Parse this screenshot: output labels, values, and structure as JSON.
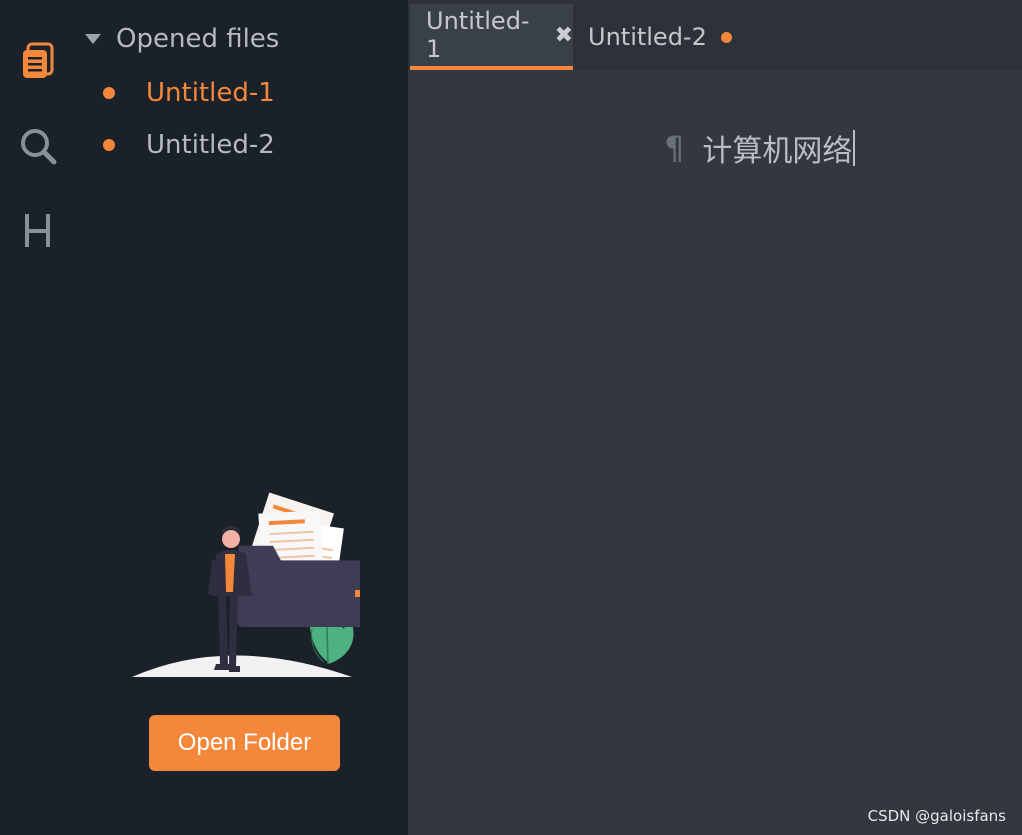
{
  "activity_bar": {
    "items": [
      {
        "name": "files-icon",
        "active": true
      },
      {
        "name": "search-icon",
        "active": false
      },
      {
        "name": "heading-icon",
        "label": "H",
        "active": false
      }
    ]
  },
  "sidebar": {
    "section_title": "Opened files",
    "files": [
      {
        "label": "Untitled-1",
        "active": true
      },
      {
        "label": "Untitled-2",
        "active": false
      }
    ],
    "open_folder_label": "Open Folder"
  },
  "tabs": [
    {
      "label": "Untitled-1",
      "active": true,
      "close_glyph": "✖"
    },
    {
      "label": "Untitled-2",
      "active": false,
      "modified": true
    }
  ],
  "editor": {
    "pilcrow": "¶",
    "text": "计算机网络"
  },
  "watermark": "CSDN @galoisfans",
  "colors": {
    "accent": "#f4873a",
    "sidebar_bg": "#1b2129",
    "editor_bg": "#333840",
    "tabbar_bg": "#2d3238",
    "text": "#b5bac1"
  }
}
